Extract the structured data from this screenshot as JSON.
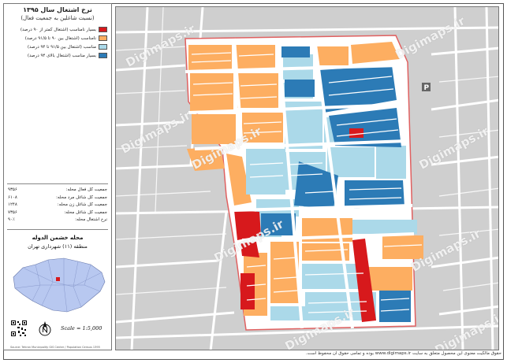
{
  "panel": {
    "title": "نرخ اشتغال سال ۱۳۹۵",
    "subtitle": "(نسبت شاغلین به جمعیت فعال)",
    "legend": [
      {
        "label": "بسیار نامناسب (اشتغال کمتر از ۹۰ درصد)",
        "color": "#d7191c"
      },
      {
        "label": "نامناسب (اشتغال بین ۹۰ تا ۹۱/۵ درصد)",
        "color": "#fdae61"
      },
      {
        "label": "مناسب (اشتغال بین ۹۱/۵ تا ۹۴ درصد)",
        "color": "#abd9e9"
      },
      {
        "label": "بسیار مناسب (اشتغال بالای ۹۴ درصد)",
        "color": "#2c7bb6"
      }
    ],
    "stats": [
      {
        "label": "جمعیت کل فعال محله:",
        "value": "۹۳۵۶"
      },
      {
        "label": "جمعیت کل شاغل مرد محله:",
        "value": "۶۱۰۸"
      },
      {
        "label": "جمعیت کل شاغل زن محله:",
        "value": "۱۲۴۸"
      },
      {
        "label": "جمعیت کل شاغل محله:",
        "value": "۷۳۵۶"
      },
      {
        "label": "نرخ اشتغال محله:",
        "value": "۹۰٪"
      }
    ],
    "area_name": "محله خشمن الدوله",
    "area_district": "منطقه (۱۱) شهرداری تهران",
    "scale": "Scale = 1:5,000",
    "tiny_text": "Source: Tehran Municipality GIS Center / Population Census 1395"
  },
  "map": {
    "watermark": "Digimaps.ir",
    "colors": {
      "red": "#d7191c",
      "orange": "#fdae61",
      "light": "#abd9e9",
      "dark": "#2c7bb6",
      "road": "#cfcfcf",
      "street": "#ffffff",
      "boundary": "#e06060"
    }
  },
  "footer": "حقوق مالکیت معنوی این محصول متعلق به سایت www.digimaps.ir بوده و تمامی حقوق آن محفوظ است."
}
